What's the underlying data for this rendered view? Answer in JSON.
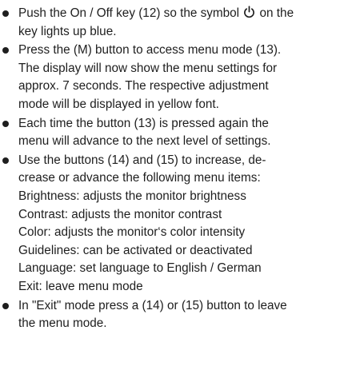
{
  "instructions": [
    {
      "lines": [
        {
          "before": "Push the On / Off key (12) so the symbol ",
          "icon": "power-icon",
          "after": " on the"
        },
        {
          "text": "key lights up blue."
        }
      ]
    },
    {
      "lines": [
        {
          "text": "Press the (M) button to access menu mode (13)."
        },
        {
          "text": "The display will now show the menu settings for"
        },
        {
          "text": "approx. 7 seconds. The respective adjustment"
        },
        {
          "text": "mode will be displayed in yellow font."
        }
      ]
    },
    {
      "lines": [
        {
          "text": "Each time the button (13) is pressed again the"
        },
        {
          "text": "menu will advance to the next level of settings."
        }
      ]
    },
    {
      "lines": [
        {
          "text": "Use the buttons (14) and (15) to increase, de-"
        },
        {
          "text": "crease or advance the following menu items:"
        },
        {
          "text": "Brightness: adjusts the monitor brightness"
        },
        {
          "text": "Contrast: adjusts the monitor contrast"
        },
        {
          "text": "Color: adjusts the monitor‘s color intensity"
        },
        {
          "text": "Guidelines: can be activated or deactivated"
        },
        {
          "text": "Language: set language to English / German"
        },
        {
          "text": "Exit: leave menu mode"
        }
      ]
    },
    {
      "lines": [
        {
          "text": "In \"Exit\" mode press a (14) or (15) button to leave"
        },
        {
          "text": "the menu mode."
        }
      ]
    }
  ],
  "colors": {
    "text": "#1e1e1e",
    "background": "#ffffff"
  }
}
